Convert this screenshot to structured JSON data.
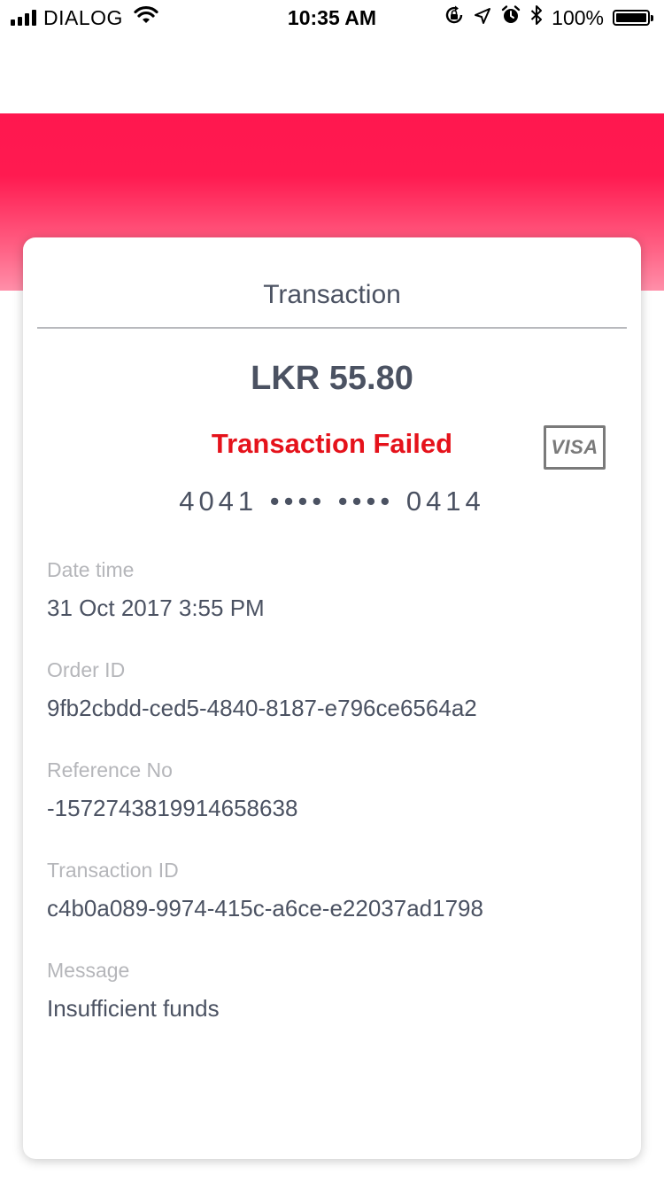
{
  "status_bar": {
    "carrier": "DIALOG",
    "time": "10:35 AM",
    "battery": "100%",
    "battery_level": 1.0,
    "icons": [
      "signal-icon",
      "wifi-icon",
      "orientation-lock-icon",
      "location-icon",
      "alarm-icon",
      "bluetooth-icon",
      "battery-icon"
    ]
  },
  "colors": {
    "header": "#ff174f",
    "text": "#4b5262",
    "label": "#b5b6ba",
    "error": "#e5121b"
  },
  "card": {
    "title": "Transaction",
    "amount": "LKR 55.80",
    "status": "Transaction Failed",
    "card_brand": "VISA",
    "card_number": "4041 •••• •••• 0414",
    "fields": [
      {
        "label": "Date time",
        "value": "31 Oct 2017 3:55 PM"
      },
      {
        "label": "Order ID",
        "value": "9fb2cbdd-ced5-4840-8187-e796ce6564a2"
      },
      {
        "label": "Reference No",
        "value": "-1572743819914658638"
      },
      {
        "label": "Transaction ID",
        "value": "c4b0a089-9974-415c-a6ce-e22037ad1798"
      },
      {
        "label": "Message",
        "value": "Insufficient funds"
      }
    ]
  }
}
